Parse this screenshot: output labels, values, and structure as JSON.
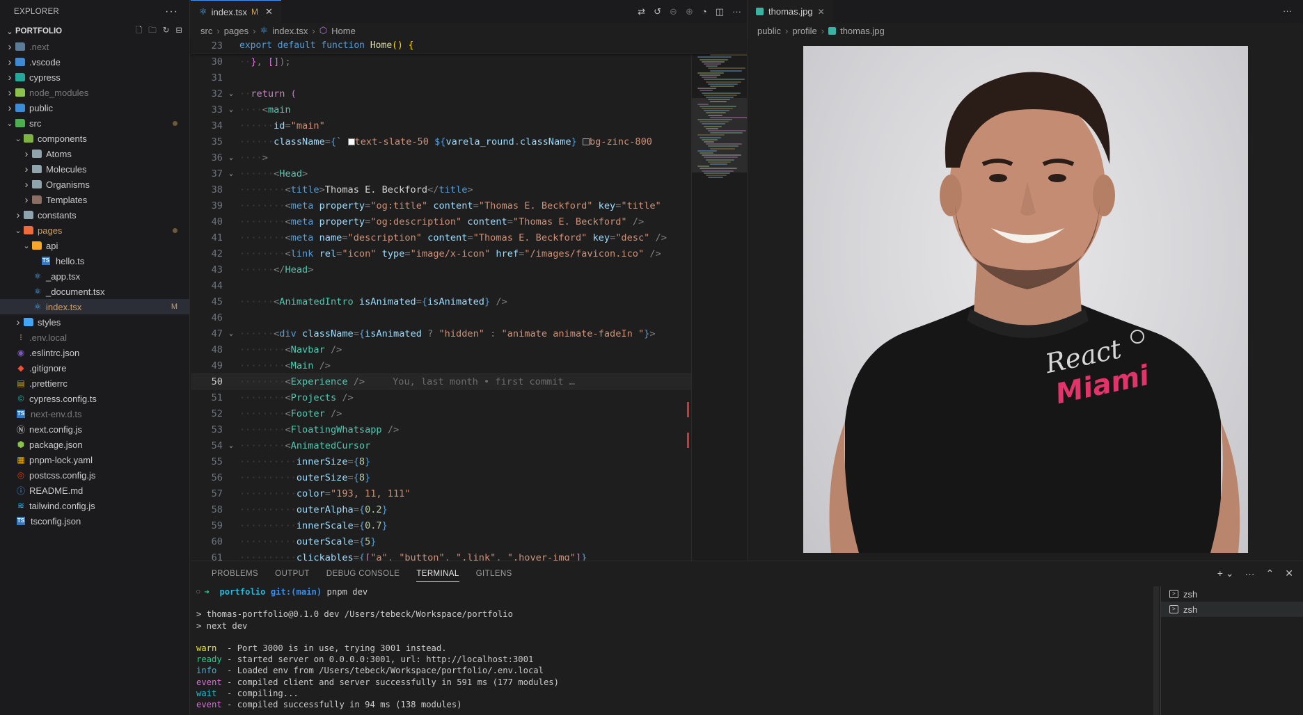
{
  "sidebar": {
    "title": "EXPLORER",
    "project": "PORTFOLIO",
    "items": [
      {
        "label": ".next",
        "kind": "folder",
        "depth": 1,
        "chev": "right",
        "icon_color": "#5b7c99",
        "dim": true
      },
      {
        "label": ".vscode",
        "kind": "folder",
        "depth": 1,
        "chev": "right",
        "icon_color": "#3c8bd6"
      },
      {
        "label": "cypress",
        "kind": "folder",
        "depth": 1,
        "chev": "right",
        "icon_color": "#26a69a"
      },
      {
        "label": "node_modules",
        "kind": "folder",
        "depth": 1,
        "chev": "right",
        "icon_color": "#8bc34a",
        "dim": true
      },
      {
        "label": "public",
        "kind": "folder",
        "depth": 1,
        "chev": "right",
        "icon_color": "#3c8bd6"
      },
      {
        "label": "src",
        "kind": "folder",
        "depth": 1,
        "chev": "down",
        "icon_color": "#4caf50",
        "dot": true
      },
      {
        "label": "components",
        "kind": "folder",
        "depth": 2,
        "chev": "down",
        "icon_color": "#7cb342"
      },
      {
        "label": "Atoms",
        "kind": "folder",
        "depth": 3,
        "chev": "right",
        "icon_color": "#90a4ae"
      },
      {
        "label": "Molecules",
        "kind": "folder",
        "depth": 3,
        "chev": "right",
        "icon_color": "#90a4ae"
      },
      {
        "label": "Organisms",
        "kind": "folder",
        "depth": 3,
        "chev": "right",
        "icon_color": "#90a4ae"
      },
      {
        "label": "Templates",
        "kind": "folder",
        "depth": 3,
        "chev": "right",
        "icon_color": "#8d6e63"
      },
      {
        "label": "constants",
        "kind": "folder",
        "depth": 2,
        "chev": "right",
        "icon_color": "#90a4ae"
      },
      {
        "label": "pages",
        "kind": "folder",
        "depth": 2,
        "chev": "down",
        "icon_color": "#ef6c3a",
        "dot": true,
        "label_color": "#d0a060"
      },
      {
        "label": "api",
        "kind": "folder",
        "depth": 3,
        "chev": "down",
        "icon_color": "#f9a825"
      },
      {
        "label": "hello.ts",
        "kind": "file",
        "depth": 4,
        "glyph": "TS",
        "glyph_color": "#3178c6"
      },
      {
        "label": "_app.tsx",
        "kind": "file",
        "depth": 3,
        "glyph": "⚛",
        "glyph_color": "#4fa6ea"
      },
      {
        "label": "_document.tsx",
        "kind": "file",
        "depth": 3,
        "glyph": "⚛",
        "glyph_color": "#4fa6ea"
      },
      {
        "label": "index.tsx",
        "kind": "file",
        "depth": 3,
        "glyph": "⚛",
        "glyph_color": "#4fa6ea",
        "selected": true,
        "modified": "M",
        "label_color": "#d0a060"
      },
      {
        "label": "styles",
        "kind": "folder",
        "depth": 2,
        "chev": "right",
        "icon_color": "#42a5f5"
      },
      {
        "label": ".env.local",
        "kind": "file",
        "depth": 1,
        "glyph": "⁝",
        "glyph_color": "#e5c07b",
        "dim": true
      },
      {
        "label": ".eslintrc.json",
        "kind": "file",
        "depth": 1,
        "glyph": "◉",
        "glyph_color": "#7e57c2"
      },
      {
        "label": ".gitignore",
        "kind": "file",
        "depth": 1,
        "glyph": "◆",
        "glyph_color": "#f05133"
      },
      {
        "label": ".prettierrc",
        "kind": "file",
        "depth": 1,
        "glyph": "▤",
        "glyph_color": "#c9a227"
      },
      {
        "label": "cypress.config.ts",
        "kind": "file",
        "depth": 1,
        "glyph": "©",
        "glyph_color": "#26a69a"
      },
      {
        "label": "next-env.d.ts",
        "kind": "file",
        "depth": 1,
        "glyph": "TS",
        "glyph_color": "#3178c6",
        "dim": true
      },
      {
        "label": "next.config.js",
        "kind": "file",
        "depth": 1,
        "glyph": "Ⓝ",
        "glyph_color": "#e0e0e0"
      },
      {
        "label": "package.json",
        "kind": "file",
        "depth": 1,
        "glyph": "⬢",
        "glyph_color": "#8bc34a"
      },
      {
        "label": "pnpm-lock.yaml",
        "kind": "file",
        "depth": 1,
        "glyph": "▦",
        "glyph_color": "#f9ad00"
      },
      {
        "label": "postcss.config.js",
        "kind": "file",
        "depth": 1,
        "glyph": "◎",
        "glyph_color": "#dd3a0a"
      },
      {
        "label": "README.md",
        "kind": "file",
        "depth": 1,
        "glyph": "ⓘ",
        "glyph_color": "#42a5f5"
      },
      {
        "label": "tailwind.config.js",
        "kind": "file",
        "depth": 1,
        "glyph": "≋",
        "glyph_color": "#38bdf8"
      },
      {
        "label": "tsconfig.json",
        "kind": "file",
        "depth": 1,
        "glyph": "TS",
        "glyph_color": "#3178c6"
      }
    ]
  },
  "editor_left": {
    "tab": {
      "label": "index.tsx",
      "flag": "M"
    },
    "breadcrumb": {
      "p1": "src",
      "p2": "pages",
      "p3": "index.tsx",
      "p4": "Home"
    },
    "sticky": {
      "num": "23",
      "text": "export default function Home() {"
    },
    "lines": [
      {
        "n": "30",
        "html": "<span class='ws'>··</span><span class='brk2'>}</span><span class='pun'>, </span><span class='brk2'>[]</span><span class='pun'>);</span>"
      },
      {
        "n": "31",
        "html": ""
      },
      {
        "n": "32",
        "fold": "v",
        "html": "<span class='ws'>··</span><span class='ret'>return</span> <span class='brk2'>(</span>"
      },
      {
        "n": "33",
        "fold": "v",
        "html": "<span class='ws'>····</span><span class='pun'>&lt;</span><span class='tag'>main</span>"
      },
      {
        "n": "34",
        "html": "<span class='ws'>······</span><span class='attr'>id</span><span class='pun'>=</span><span class='str'>\"main\"</span>"
      },
      {
        "n": "35",
        "html": "<span class='ws'>······</span><span class='attr'>className</span><span class='pun'>=</span><span class='kw'>{`</span> <span style='display:inline-block;width:10px;height:10px;background:#f8fafc;border:1px solid #888;vertical-align:middle'></span><span class='str'>text-slate-50 </span><span class='kw'>${</span><span class='attr'>varela_round</span><span class='pun'>.</span><span class='attr'>className</span><span class='kw'>}</span> <span style='display:inline-block;width:10px;height:10px;background:#27272a;border:1px solid #aaa;vertical-align:middle'></span><span class='str'>bg-zinc-800</span>"
      },
      {
        "n": "36",
        "fold": "v",
        "html": "<span class='ws'>····</span><span class='pun'>&gt;</span>"
      },
      {
        "n": "37",
        "fold": "v",
        "html": "<span class='ws'>······</span><span class='pun'>&lt;</span><span class='tag'>Head</span><span class='pun'>&gt;</span>"
      },
      {
        "n": "38",
        "html": "<span class='ws'>········</span><span class='pun'>&lt;</span><span class='kw'>title</span><span class='pun'>&gt;</span>Thomas E. Beckford<span class='pun'>&lt;/</span><span class='kw'>title</span><span class='pun'>&gt;</span>"
      },
      {
        "n": "39",
        "html": "<span class='ws'>········</span><span class='pun'>&lt;</span><span class='kw'>meta</span> <span class='attr'>property</span><span class='pun'>=</span><span class='str'>\"og:title\"</span> <span class='attr'>content</span><span class='pun'>=</span><span class='str'>\"Thomas E. Beckford\"</span> <span class='attr'>key</span><span class='pun'>=</span><span class='str'>\"title\"</span>"
      },
      {
        "n": "40",
        "html": "<span class='ws'>········</span><span class='pun'>&lt;</span><span class='kw'>meta</span> <span class='attr'>property</span><span class='pun'>=</span><span class='str'>\"og:description\"</span> <span class='attr'>content</span><span class='pun'>=</span><span class='str'>\"Thomas E. Beckford\"</span> <span class='pun'>/&gt;</span>"
      },
      {
        "n": "41",
        "html": "<span class='ws'>········</span><span class='pun'>&lt;</span><span class='kw'>meta</span> <span class='attr'>name</span><span class='pun'>=</span><span class='str'>\"description\"</span> <span class='attr'>content</span><span class='pun'>=</span><span class='str'>\"Thomas E. Beckford\"</span> <span class='attr'>key</span><span class='pun'>=</span><span class='str'>\"desc\"</span> <span class='pun'>/&gt;</span>"
      },
      {
        "n": "42",
        "html": "<span class='ws'>········</span><span class='pun'>&lt;</span><span class='kw'>link</span> <span class='attr'>rel</span><span class='pun'>=</span><span class='str'>\"icon\"</span> <span class='attr'>type</span><span class='pun'>=</span><span class='str'>\"image/x-icon\"</span> <span class='attr'>href</span><span class='pun'>=</span><span class='str'>\"/images/favicon.ico\"</span> <span class='pun'>/&gt;</span>"
      },
      {
        "n": "43",
        "html": "<span class='ws'>······</span><span class='pun'>&lt;/</span><span class='tag'>Head</span><span class='pun'>&gt;</span>"
      },
      {
        "n": "44",
        "html": ""
      },
      {
        "n": "45",
        "html": "<span class='ws'>······</span><span class='pun'>&lt;</span><span class='tag'>AnimatedIntro</span> <span class='attr'>isAnimated</span><span class='pun'>=</span><span class='kw'>{</span><span class='attr'>isAnimated</span><span class='kw'>}</span> <span class='pun'>/&gt;</span>"
      },
      {
        "n": "46",
        "html": ""
      },
      {
        "n": "47",
        "fold": "v",
        "html": "<span class='ws'>······</span><span class='pun'>&lt;</span><span class='kw'>div</span> <span class='attr'>className</span><span class='pun'>=</span><span class='kw'>{</span><span class='attr'>isAnimated</span> <span class='pun'>?</span> <span class='str'>\"hidden\"</span> <span class='pun'>:</span> <span class='str'>\"animate animate-fadeIn \"</span><span class='kw'>}</span><span class='pun'>&gt;</span>"
      },
      {
        "n": "48",
        "html": "<span class='ws'>········</span><span class='pun'>&lt;</span><span class='tag'>Navbar</span> <span class='pun'>/&gt;</span>"
      },
      {
        "n": "49",
        "html": "<span class='ws'>········</span><span class='pun'>&lt;</span><span class='tag'>Main</span> <span class='pun'>/&gt;</span>"
      },
      {
        "n": "50",
        "cur": true,
        "html": "<span class='ws'>········</span><span class='pun'>&lt;</span><span class='tag'>Experience</span> <span class='pun'>/&gt;</span><span class='ghost'>You, last month • first commit …</span>"
      },
      {
        "n": "51",
        "html": "<span class='ws'>········</span><span class='pun'>&lt;</span><span class='tag'>Projects</span> <span class='pun'>/&gt;</span>"
      },
      {
        "n": "52",
        "html": "<span class='ws'>········</span><span class='pun'>&lt;</span><span class='tag'>Footer</span> <span class='pun'>/&gt;</span>"
      },
      {
        "n": "53",
        "html": "<span class='ws'>········</span><span class='pun'>&lt;</span><span class='tag'>FloatingWhatsapp</span> <span class='pun'>/&gt;</span>"
      },
      {
        "n": "54",
        "fold": "v",
        "html": "<span class='ws'>········</span><span class='pun'>&lt;</span><span class='tag'>AnimatedCursor</span>"
      },
      {
        "n": "55",
        "html": "<span class='ws'>··········</span><span class='attr'>innerSize</span><span class='pun'>=</span><span class='kw'>{</span><span class='num'>8</span><span class='kw'>}</span>"
      },
      {
        "n": "56",
        "html": "<span class='ws'>··········</span><span class='attr'>outerSize</span><span class='pun'>=</span><span class='kw'>{</span><span class='num'>8</span><span class='kw'>}</span>"
      },
      {
        "n": "57",
        "html": "<span class='ws'>··········</span><span class='attr'>color</span><span class='pun'>=</span><span class='str'>\"193, 11, 111\"</span>"
      },
      {
        "n": "58",
        "html": "<span class='ws'>··········</span><span class='attr'>outerAlpha</span><span class='pun'>=</span><span class='kw'>{</span><span class='num'>0.2</span><span class='kw'>}</span>"
      },
      {
        "n": "59",
        "html": "<span class='ws'>··········</span><span class='attr'>innerScale</span><span class='pun'>=</span><span class='kw'>{</span><span class='num'>0.7</span><span class='kw'>}</span>"
      },
      {
        "n": "60",
        "html": "<span class='ws'>··········</span><span class='attr'>outerScale</span><span class='pun'>=</span><span class='kw'>{</span><span class='num'>5</span><span class='kw'>}</span>"
      },
      {
        "n": "61",
        "html": "<span class='ws'>··········</span><span class='attr'>clickables</span><span class='pun'>=</span><span class='kw'>{</span><span class='brk2'>[</span><span class='str'>\"a\"</span><span class='pun'>, </span><span class='str'>\"button\"</span><span class='pun'>, </span><span class='str'>\".link\"</span><span class='pun'>, </span><span class='str'>\".hover-img\"</span><span class='brk2'>]</span><span class='kw'>}</span>"
      }
    ]
  },
  "editor_right": {
    "tab": {
      "label": "thomas.jpg"
    },
    "breadcrumb": {
      "p1": "public",
      "p2": "profile",
      "p3": "thomas.jpg"
    },
    "shirt_text_1": "React",
    "shirt_text_2": "Miami"
  },
  "panel": {
    "tabs": [
      "PROBLEMS",
      "OUTPUT",
      "DEBUG CONSOLE",
      "TERMINAL",
      "GITLENS"
    ],
    "active_tab": "TERMINAL",
    "prompt_dir": "portfolio",
    "prompt_git": "git:(main)",
    "prompt_cmd": "pnpm dev",
    "out_1": "> thomas-portfolio@0.1.0 dev /Users/tebeck/Workspace/portfolio",
    "out_2": "> next dev",
    "logs": [
      {
        "level": "warn",
        "color": "#e5e510",
        "msg": " - Port 3000 is in use, trying 3001 instead."
      },
      {
        "level": "ready",
        "color": "#23d18b",
        "msg": "- started server on 0.0.0.0:3001, url: http://localhost:3001"
      },
      {
        "level": "info",
        "color": "#29b8db",
        "msg": " - Loaded env from /Users/tebeck/Workspace/portfolio/.env.local"
      },
      {
        "level": "event",
        "color": "#d670d6",
        "msg": "- compiled client and server successfully in 591 ms (177 modules)"
      },
      {
        "level": "wait",
        "color": "#29b8db",
        "msg": " - compiling..."
      },
      {
        "level": "event",
        "color": "#d670d6",
        "msg": "- compiled successfully in 94 ms (138 modules)"
      }
    ],
    "terminals": [
      "zsh",
      "zsh"
    ]
  }
}
